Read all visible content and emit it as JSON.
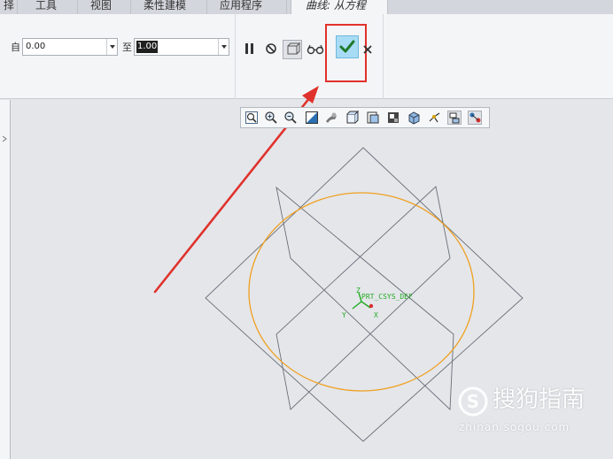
{
  "tabs": [
    {
      "label": "择",
      "active": false
    },
    {
      "label": "工具",
      "active": false
    },
    {
      "label": "视图",
      "active": false
    },
    {
      "label": "柔性建模",
      "active": false
    },
    {
      "label": "应用程序",
      "active": false
    },
    {
      "label": "曲线: 从方程",
      "active": true
    }
  ],
  "ribbon": {
    "from_label": "自",
    "from_value": "0.00",
    "to_label": "至",
    "to_value": "1.00",
    "pause_icon": "pause-icon",
    "no_preview_icon": "circle-slash-icon",
    "preview_icon": "preview-box-icon",
    "verify_icon": "glasses-icon",
    "ok_icon": "checkmark-icon",
    "cancel_icon": "close-icon"
  },
  "view_toolbar": {
    "icons": [
      "zoom-fit-icon",
      "zoom-in-icon",
      "zoom-out-icon",
      "repaint-icon",
      "spin-center-icon",
      "saved-views-icon",
      "display-style-icon",
      "section-icon",
      "perspective-icon",
      "datum-display-icon",
      "annotation-display-icon",
      "connection-display-icon"
    ]
  },
  "scene": {
    "csys_label": "PRT_CSYS_DEF",
    "axis_x": "X",
    "axis_y": "Y",
    "axis_z": "Z",
    "colors": {
      "curve": "#f0a020",
      "datum_planes": "#6a6f78",
      "csys": "#22aa22",
      "arrow": "#e0322c"
    }
  },
  "watermark": {
    "main": "搜狗指南",
    "sub": "zhinan.sogou.com"
  }
}
